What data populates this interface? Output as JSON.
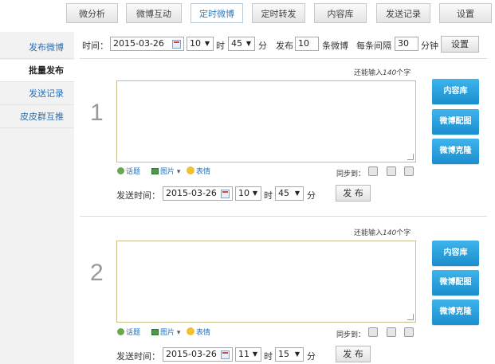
{
  "top_tabs": [
    {
      "label": "微分析",
      "active": false
    },
    {
      "label": "微博互动",
      "active": false
    },
    {
      "label": "定时微博",
      "active": true
    },
    {
      "label": "定时转发",
      "active": false
    },
    {
      "label": "内容库",
      "active": false
    },
    {
      "label": "发送记录",
      "active": false
    },
    {
      "label": "设置",
      "active": false
    }
  ],
  "sidebar": {
    "items": [
      {
        "label": "发布微博",
        "active": false
      },
      {
        "label": "批量发布",
        "active": true
      },
      {
        "label": "发送记录",
        "active": false
      },
      {
        "label": "皮皮群互推",
        "active": false
      }
    ]
  },
  "settings_row": {
    "time_label": "时间：",
    "date": "2015-03-26",
    "hour": "10",
    "hour_unit": "时",
    "minute": "45",
    "minute_unit": "分",
    "publish_label": "发布",
    "count": "10",
    "count_unit": "条微博",
    "interval_label": "每条间隔",
    "interval": "30",
    "interval_unit": "分钟",
    "set_button": "设置"
  },
  "posts": [
    {
      "index": "1",
      "remaining_prefix": "还能输入",
      "remaining_count": "140",
      "remaining_suffix": "个字",
      "text": "",
      "tools": {
        "topic": "话题",
        "image": "图片",
        "emotion": "表情"
      },
      "sync_label": "同步到：",
      "send_time_label": "发送时间：",
      "date": "2015-03-26",
      "hour": "10",
      "hour_unit": "时",
      "minute": "45",
      "minute_unit": "分",
      "publish_button": "发 布",
      "side_buttons": [
        "内容库",
        "微博配图",
        "微博克隆"
      ]
    },
    {
      "index": "2",
      "remaining_prefix": "还能输入",
      "remaining_count": "140",
      "remaining_suffix": "个字",
      "text": "",
      "tools": {
        "topic": "话题",
        "image": "图片",
        "emotion": "表情"
      },
      "sync_label": "同步到：",
      "send_time_label": "发送时间：",
      "date": "2015-03-26",
      "hour": "11",
      "hour_unit": "时",
      "minute": "15",
      "minute_unit": "分",
      "publish_button": "发 布",
      "side_buttons": [
        "内容库",
        "微博配图",
        "微博克隆"
      ]
    }
  ],
  "icons": [
    "calendar-icon",
    "topic-icon",
    "image-icon",
    "emotion-icon",
    "dropdown-arrow-icon",
    "sync-platform-icon"
  ],
  "colors": {
    "accent": "#2d7fc1",
    "blue_button": "#1b8fce",
    "link": "#2b6fb5"
  }
}
